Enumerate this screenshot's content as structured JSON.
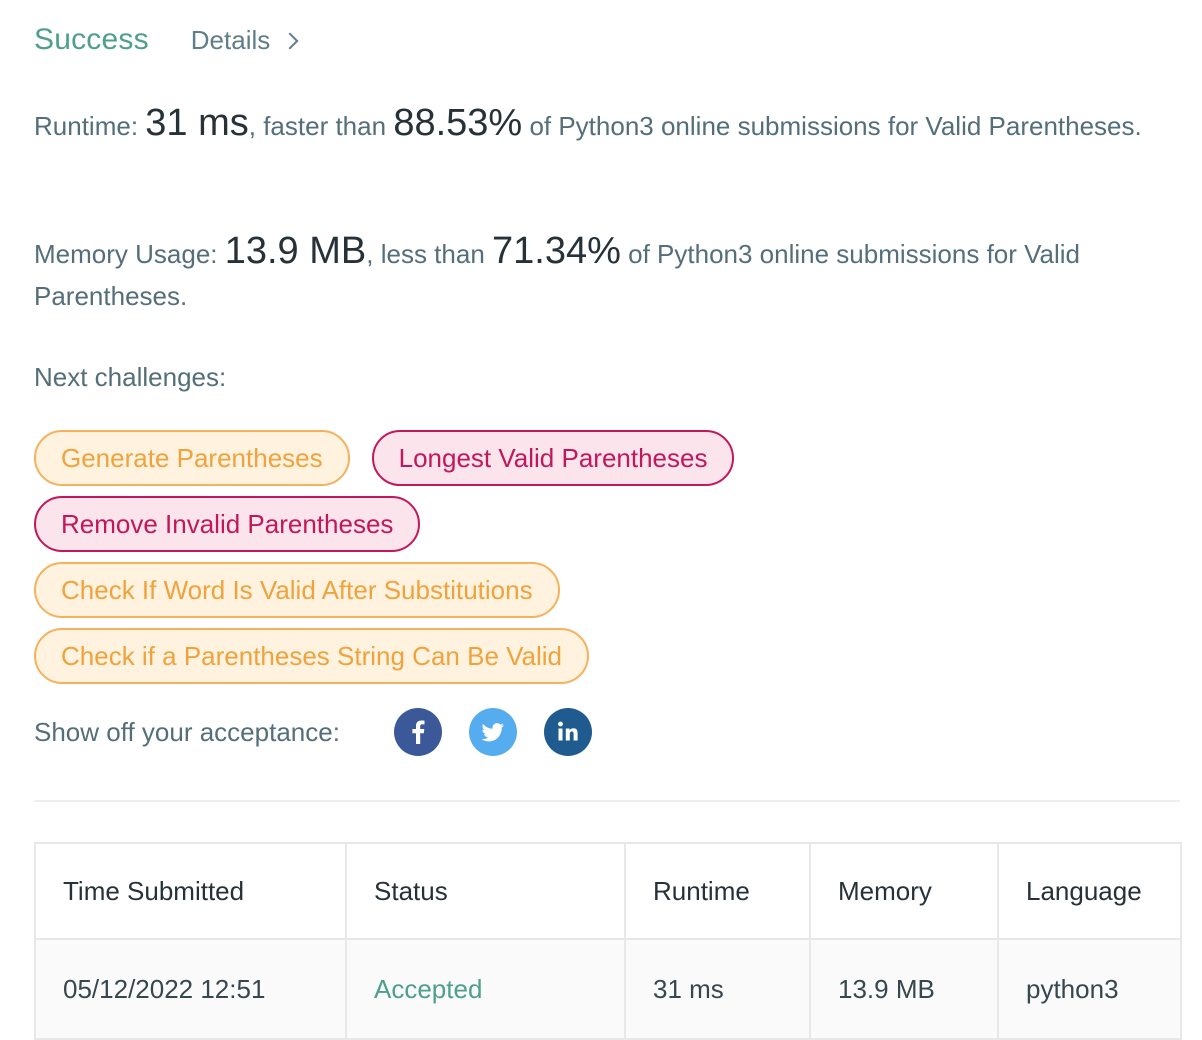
{
  "header": {
    "status": "Success",
    "details_label": "Details"
  },
  "runtime": {
    "label": "Runtime:",
    "value": "31 ms",
    "comparison": ", faster than",
    "percent": "88.53%",
    "suffix": "of Python3 online submissions for Valid Parentheses."
  },
  "memory": {
    "label": "Memory Usage:",
    "value": "13.9 MB",
    "comparison": ", less than",
    "percent": "71.34%",
    "suffix": "of Python3 online submissions for Valid Parentheses."
  },
  "next_challenges": {
    "label": "Next challenges:",
    "items": [
      {
        "title": "Generate Parentheses",
        "difficulty": "medium"
      },
      {
        "title": "Longest Valid Parentheses",
        "difficulty": "hard"
      },
      {
        "title": "Remove Invalid Parentheses",
        "difficulty": "hard"
      },
      {
        "title": "Check If Word Is Valid After Substitutions",
        "difficulty": "medium"
      },
      {
        "title": "Check if a Parentheses String Can Be Valid",
        "difficulty": "medium"
      }
    ]
  },
  "share": {
    "label": "Show off your acceptance:",
    "networks": [
      "facebook-icon",
      "twitter-icon",
      "linkedin-icon"
    ]
  },
  "colors": {
    "success": "#4e9f8d",
    "medium_text": "#f0a23c",
    "medium_bg": "#fff3e0",
    "hard_text": "#c2185b",
    "hard_bg": "#fce4ec",
    "facebook": "#3b5998",
    "twitter": "#55acee",
    "linkedin": "#1f5b8f"
  },
  "table": {
    "headers": [
      "Time Submitted",
      "Status",
      "Runtime",
      "Memory",
      "Language"
    ],
    "rows": [
      [
        "05/12/2022 12:51",
        "Accepted",
        "31 ms",
        "13.9 MB",
        "python3"
      ]
    ]
  }
}
